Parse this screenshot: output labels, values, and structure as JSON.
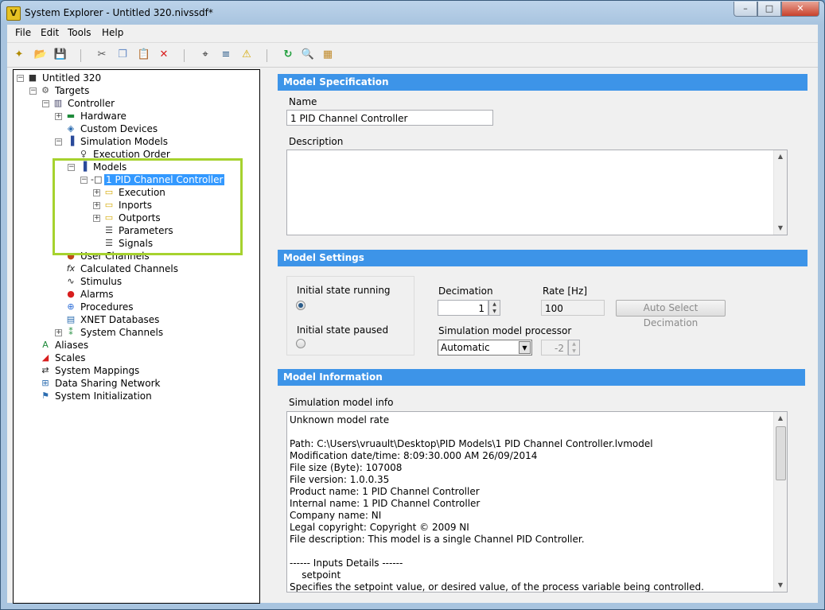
{
  "window": {
    "title": "System Explorer - Untitled 320.nivssdf*",
    "icon_glyph": "V",
    "btn_min": "–",
    "btn_max": "□",
    "btn_close": "✕"
  },
  "menu": [
    "File",
    "Edit",
    "Tools",
    "Help"
  ],
  "toolbar": {
    "icons": [
      "new-icon",
      "open-icon",
      "save-icon",
      "cut-icon",
      "copy-icon",
      "paste-icon",
      "delete-icon",
      "find-icon",
      "properties-icon",
      "warning-icon",
      "refresh-icon",
      "browse-icon",
      "deploy-icon"
    ],
    "glyphs": {
      "new": "✦",
      "open": "📂",
      "save": "💾",
      "cut": "✂",
      "copy": "❐",
      "paste": "📋",
      "delete": "✕",
      "find": "⌖",
      "properties": "≡",
      "warning": "⚠",
      "refresh": "↻",
      "browse": "🔍",
      "deploy": "▦"
    }
  },
  "tree": {
    "untitled": "Untitled 320",
    "targets": "Targets",
    "controller": "Controller",
    "hardware": "Hardware",
    "custom_devices": "Custom Devices",
    "simulation_models": "Simulation Models",
    "execution_order": "Execution Order",
    "models": "Models",
    "pid_controller": "1 PID Channel Controller",
    "execution": "Execution",
    "inports": "Inports",
    "outports": "Outports",
    "parameters": "Parameters",
    "signals": "Signals",
    "user_channels": "User Channels",
    "calculated_channels": "Calculated Channels",
    "stimulus": "Stimulus",
    "alarms": "Alarms",
    "procedures": "Procedures",
    "xnet_databases": "XNET Databases",
    "system_channels": "System Channels",
    "aliases": "Aliases",
    "scales": "Scales",
    "system_mappings": "System Mappings",
    "data_sharing_network": "Data Sharing Network",
    "system_initialization": "System Initialization",
    "expand": "+",
    "collapse": "−"
  },
  "spec": {
    "header": "Model Specification",
    "name_label": "Name",
    "name_value": "1 PID Channel Controller",
    "description_label": "Description",
    "description_value": ""
  },
  "settings": {
    "header": "Model Settings",
    "initial_running": "Initial state running",
    "initial_paused": "Initial state paused",
    "decimation_label": "Decimation",
    "decimation_value": "1",
    "rate_label": "Rate [Hz]",
    "rate_value": "100",
    "auto_select": "Auto Select Decimation",
    "processor_label": "Simulation model processor",
    "processor_value": "Automatic",
    "processor_num": "-2",
    "spin_up": "▲",
    "spin_down": "▼",
    "dropdown": "▼"
  },
  "info": {
    "header": "Model Information",
    "label": "Simulation model info",
    "lines": [
      "Unknown model rate",
      "",
      "Path: C:\\Users\\vruault\\Desktop\\PID Models\\1 PID Channel Controller.lvmodel",
      "Modification date/time: 8:09:30.000 AM 26/09/2014",
      "File size (Byte): 107008",
      "File version: 1.0.0.35",
      "Product name: 1 PID Channel Controller",
      "Internal name: 1 PID Channel Controller",
      "Company name: NI",
      "Legal copyright: Copyright © 2009 NI",
      "File description: This model is a single Channel PID Controller.",
      "",
      "------ Inputs Details ------",
      "    setpoint",
      "Specifies the setpoint value, or desired value, of the process variable being controlled."
    ],
    "scroll_up": "▲",
    "scroll_down": "▼"
  }
}
